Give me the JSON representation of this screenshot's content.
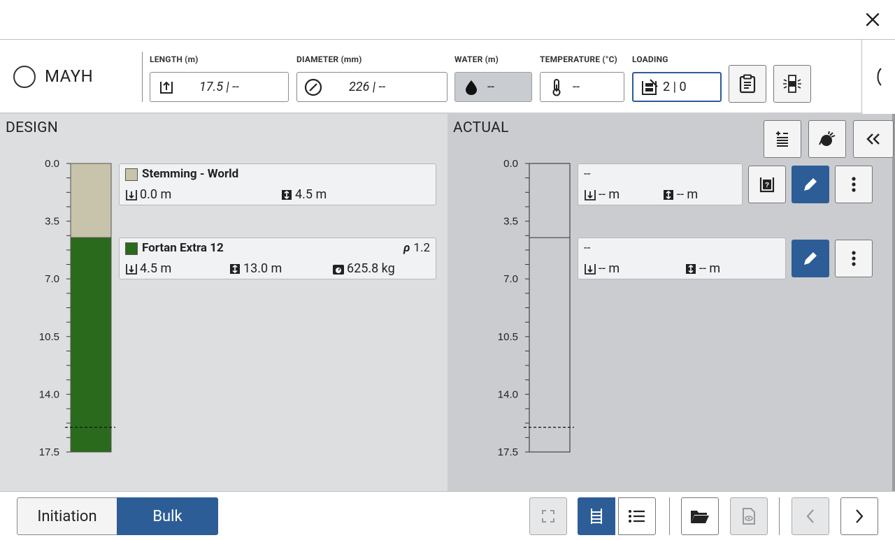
{
  "window": {
    "close_label": "Close"
  },
  "hole": {
    "name": "MAYH"
  },
  "fields": {
    "length": {
      "label": "LENGTH (m)",
      "value": "17.5 | --"
    },
    "diameter": {
      "label": "DIAMETER (mm)",
      "value": "226 | --"
    },
    "water": {
      "label": "WATER (m)",
      "value": "--"
    },
    "temperature": {
      "label": "TEMPERATURE (°C)",
      "value": "--"
    },
    "loading": {
      "label": "LOADING",
      "value": "2 | 0"
    }
  },
  "design": {
    "title": "DESIGN",
    "axis_ticks": [
      "0.0",
      "3.5",
      "7.0",
      "10.5",
      "14.0",
      "17.5"
    ],
    "decks": [
      {
        "name": "Stemming - World",
        "color": "#c8c3ab",
        "from": "0.0 m",
        "length": "4.5 m",
        "density_label": "",
        "density": "",
        "mass": ""
      },
      {
        "name": "Fortan Extra 12",
        "color": "#2a6a1c",
        "from": "4.5 m",
        "length": "13.0 m",
        "density_label": "ρ",
        "density": "1.2",
        "mass": "625.8 kg"
      }
    ],
    "column": {
      "total_depth": 17.5,
      "water_line": 16.0,
      "segments": [
        {
          "start": 0.0,
          "end": 4.5,
          "color": "#c8c3ab"
        },
        {
          "start": 4.5,
          "end": 17.5,
          "color": "#2a6a1c"
        }
      ]
    }
  },
  "actual": {
    "title": "ACTUAL",
    "axis_ticks": [
      "0.0",
      "3.5",
      "7.0",
      "10.5",
      "14.0",
      "17.5"
    ],
    "decks": [
      {
        "name": "--",
        "from": "-- m",
        "length": "-- m"
      },
      {
        "name": "--",
        "from": "-- m",
        "length": "-- m"
      }
    ],
    "column": {
      "total_depth": 17.5,
      "water_line": 16.0,
      "divider": 4.5
    }
  },
  "footer": {
    "tab_initiation": "Initiation",
    "tab_bulk": "Bulk"
  },
  "colors": {
    "accent": "#2d5d96",
    "stemming": "#c8c3ab",
    "explosive": "#2a6a1c"
  }
}
